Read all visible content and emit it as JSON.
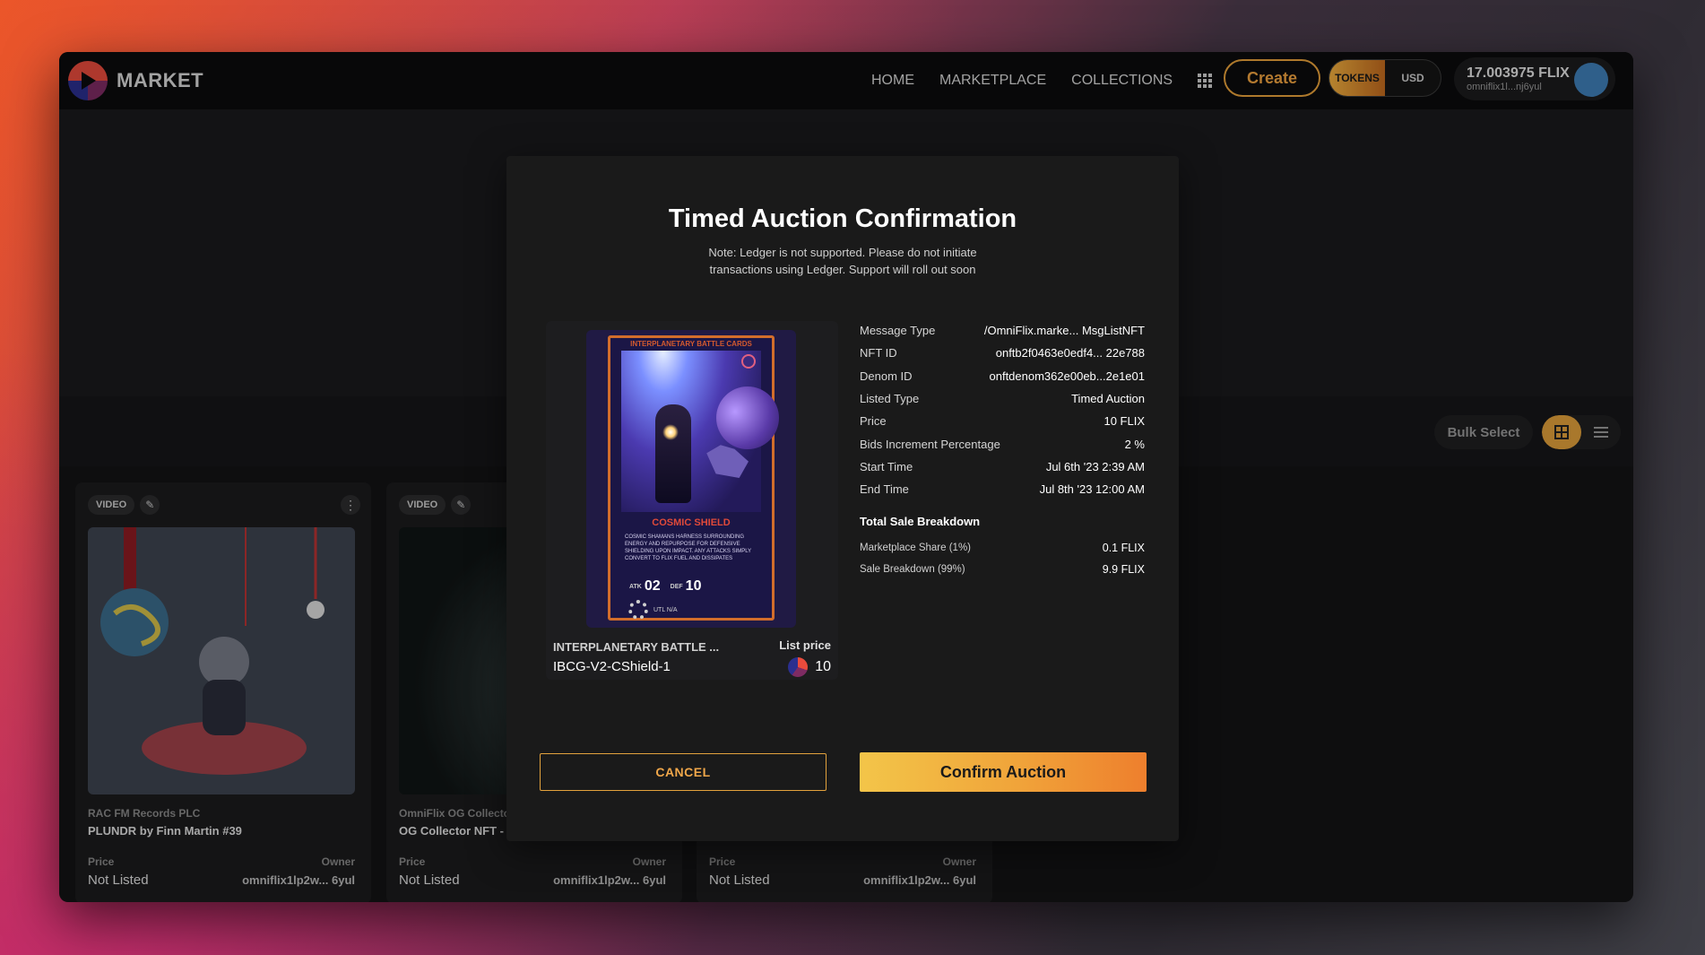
{
  "brand": {
    "name": "MARKET"
  },
  "nav": {
    "links": [
      "HOME",
      "MARKETPLACE",
      "COLLECTIONS"
    ],
    "create_label": "Create",
    "currency": {
      "tokens": "TOKENS",
      "usd": "USD",
      "selected": "TOKENS"
    }
  },
  "wallet": {
    "balance": "17.003975 FLIX",
    "address": "omniflix1l...nj6yul"
  },
  "toolbar": {
    "bulk_select_label": "Bulk Select",
    "view_mode": "grid"
  },
  "cards": [
    {
      "tags": [
        "VIDEO"
      ],
      "collection": "RAC FM Records PLC",
      "name": "PLUNDR by Finn Martin #39",
      "price_label": "Price",
      "price": "Not Listed",
      "owner_label": "Owner",
      "owner": "omniflix1lp2w... 6yul"
    },
    {
      "tags": [
        "VIDEO"
      ],
      "collection": "OmniFlix OG Collecto",
      "name": "OG Collector NFT -",
      "price_label": "Price",
      "price": "Not Listed",
      "owner_label": "Owner",
      "owner": "omniflix1lp2w... 6yul"
    },
    {
      "tags": [],
      "collection": "",
      "name": "",
      "price_label": "Price",
      "price": "Not Listed",
      "owner_label": "Owner",
      "owner": "omniflix1lp2w... 6yul"
    }
  ],
  "modal": {
    "title": "Timed Auction Confirmation",
    "note": "Note: Ledger is not supported. Please do not initiate transactions using Ledger. Support will roll out soon",
    "nft": {
      "card_header": "INTERPLANETARY BATTLE CARDS",
      "card_name": "COSMIC SHIELD",
      "card_desc": "COSMIC SHAMANS HARNESS SURROUNDING ENERGY AND REPURPOSE FOR DEFENSIVE SHIELDING UPON IMPACT. ANY ATTACKS SIMPLY CONVERT TO FLIX FUEL AND DISSIPATES",
      "atk_label": "ATK",
      "atk": "02",
      "def_label": "DEF",
      "def": "10",
      "util_label": "UTL",
      "util_value": "N/A",
      "collection": "INTERPLANETARY BATTLE ...",
      "id": "IBCG-V2-CShield-1",
      "list_price_label": "List price",
      "list_price": "10"
    },
    "details": [
      {
        "key": "Message Type",
        "value": "/OmniFlix.marke... MsgListNFT"
      },
      {
        "key": "NFT ID",
        "value": "onftb2f0463e0edf4... 22e788"
      },
      {
        "key": "Denom ID",
        "value": "onftdenom362e00eb...2e1e01"
      },
      {
        "key": "Listed Type",
        "value": "Timed Auction"
      },
      {
        "key": "Price",
        "value": "10 FLIX"
      },
      {
        "key": "Bids Increment Percentage",
        "value": "2 %"
      },
      {
        "key": "Start Time",
        "value": "Jul 6th '23 2:39 AM"
      },
      {
        "key": "End Time",
        "value": "Jul 8th '23 12:00 AM"
      }
    ],
    "breakdown": {
      "title": "Total Sale Breakdown",
      "rows": [
        {
          "key": "Marketplace Share (1%)",
          "value": "0.1 FLIX"
        },
        {
          "key": "Sale Breakdown (99%)",
          "value": "9.9 FLIX"
        }
      ]
    },
    "cancel_label": "CANCEL",
    "confirm_label": "Confirm Auction"
  },
  "colors": {
    "accent": "#f0a43a",
    "background": "#131315",
    "modal": "#1a1a1a"
  }
}
